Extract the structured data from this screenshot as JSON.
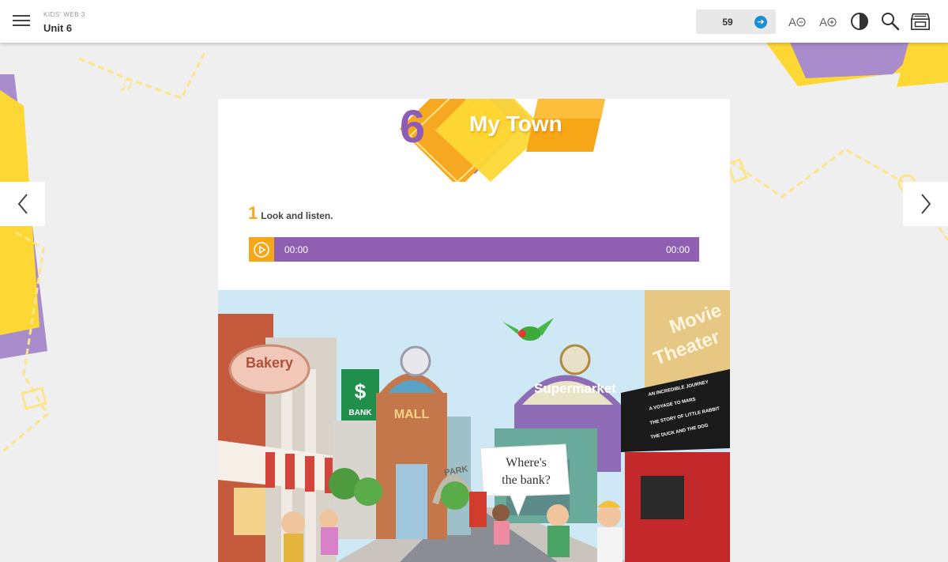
{
  "header": {
    "course_label": "KIDS' WEB 3",
    "unit_label": "Unit 6",
    "page_number": "59"
  },
  "toolbar": {
    "icons": [
      "menu-icon",
      "go-arrow-icon",
      "font-decrease-icon",
      "font-increase-icon",
      "contrast-icon",
      "search-icon",
      "archive-box-icon"
    ]
  },
  "unit_banner": {
    "number": "6",
    "title": "My Town"
  },
  "activity": {
    "number": "1",
    "instruction": "Look and listen."
  },
  "audio_player": {
    "current_time": "00:00",
    "total_time": "00:00"
  },
  "illustration": {
    "signs": {
      "bakery": "Bakery",
      "bank": "BANK",
      "bank_symbol": "$",
      "mall": "MALL",
      "park": "PARK",
      "supermarket": "Supermarket",
      "movie_theater_line1": "Movie",
      "movie_theater_line2": "Theater"
    },
    "marquee": [
      "AN INCREDIBLE JOURNEY",
      "A VOYAGE TO MARS",
      "THE STORY OF LITTLE RABBIT",
      "THE DUCK AND THE DOG"
    ],
    "speech_bubble_line1": "Where's",
    "speech_bubble_line2": "the bank?"
  },
  "colors": {
    "accent_purple": "#8f5fb2",
    "accent_orange": "#f6a717",
    "accent_yellow": "#fdd835",
    "go_blue": "#1b8fd6"
  }
}
